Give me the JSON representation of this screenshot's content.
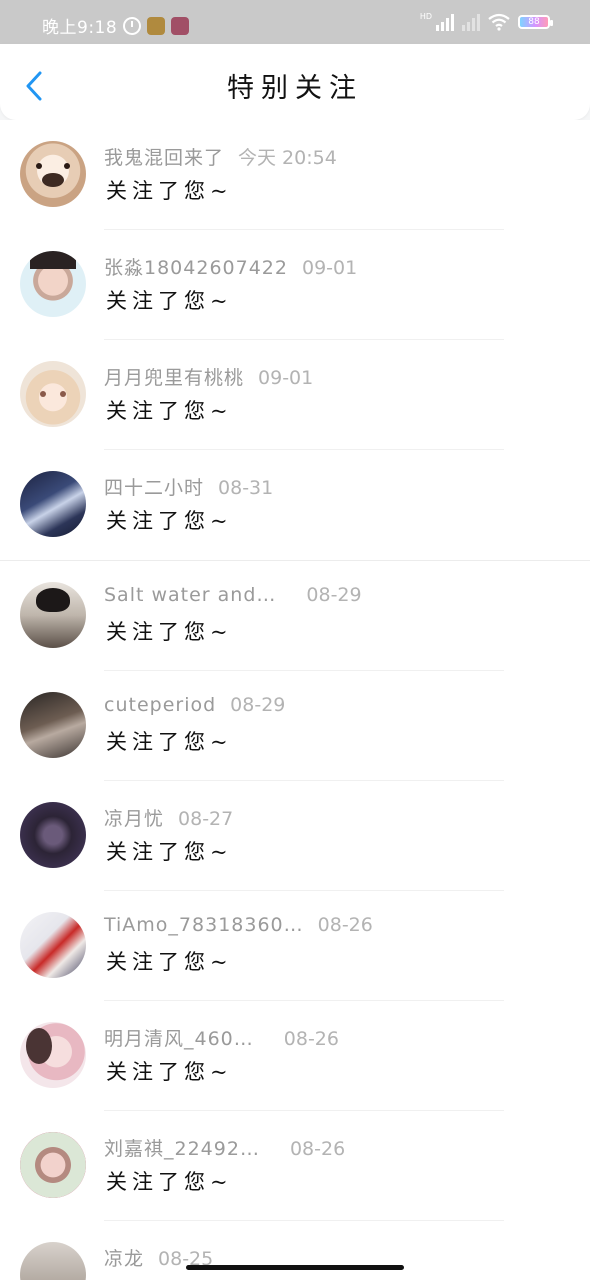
{
  "status_bar": {
    "time": "晚上9:18",
    "hd_label": "HD",
    "battery_label": "88"
  },
  "header": {
    "title": "特别关注"
  },
  "notifications": [
    {
      "name": "我鬼混回来了",
      "time": "今天 20:54",
      "message": "关注了您~"
    },
    {
      "name": "张淼18042607422",
      "time": "09-01",
      "message": "关注了您~"
    },
    {
      "name": "月月兜里有桃桃",
      "time": "09-01",
      "message": "关注了您~"
    },
    {
      "name": "四十二小时",
      "time": "08-31",
      "message": "关注了您~"
    },
    {
      "name": "Salt water and…",
      "time": "08-29",
      "message": "关注了您~"
    },
    {
      "name": "cuteperiod",
      "time": "08-29",
      "message": "关注了您~"
    },
    {
      "name": "凉月忧",
      "time": "08-27",
      "message": "关注了您~"
    },
    {
      "name": "TiAmo_78318360…",
      "time": "08-26",
      "message": "关注了您~"
    },
    {
      "name": "明月清风_460…",
      "time": "08-26",
      "message": "关注了您~"
    },
    {
      "name": "刘嘉祺_22492…",
      "time": "08-26",
      "message": "关注了您~"
    },
    {
      "name": "凉龙",
      "time": "08-25",
      "message": ""
    }
  ]
}
